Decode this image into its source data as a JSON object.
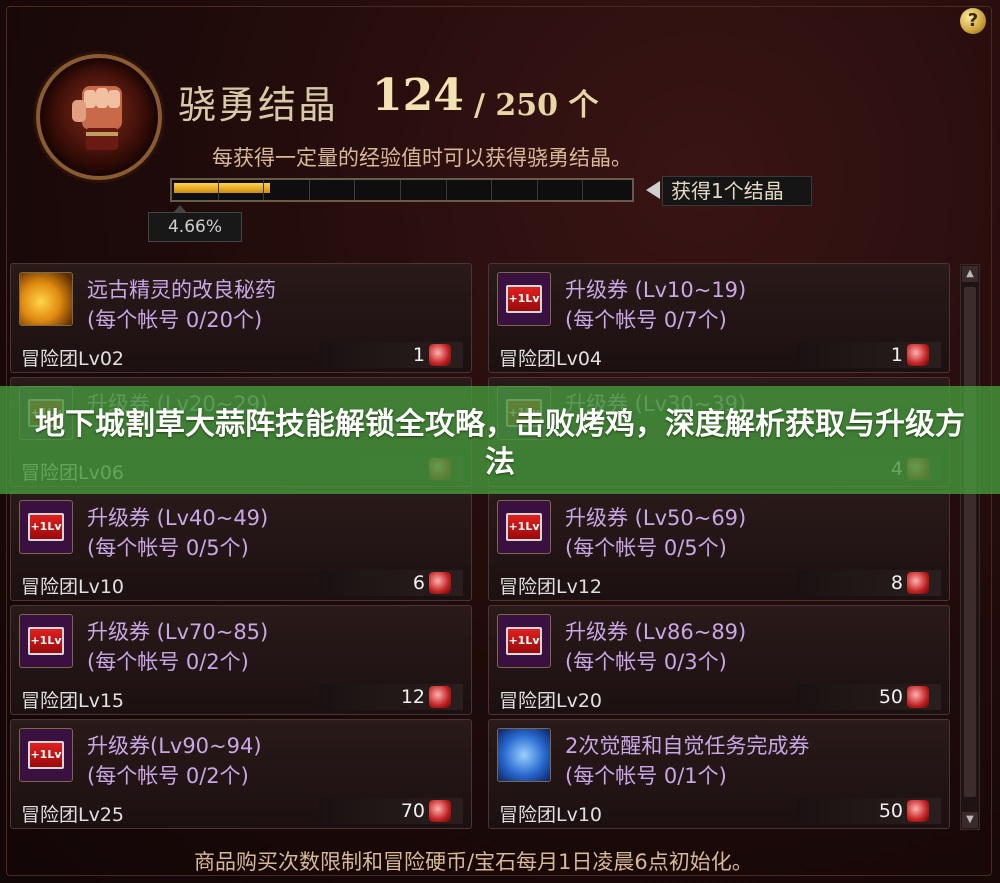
{
  "header": {
    "title": "骁勇结晶",
    "count": "124",
    "max": "/ 250 个",
    "description": "每获得一定量的经验值时可以获得骁勇结晶。",
    "progress_label": "4.66%",
    "progress": 0.0466,
    "reward_label": "获得1个结晶",
    "help": "?"
  },
  "items": [
    {
      "name": "远古精灵的改良秘药",
      "limit": "(每个帐号 0/20个)",
      "req": "冒险团Lv02",
      "price": "1",
      "icon": "potion-icon"
    },
    {
      "name": "升级券 (Lv10~19)",
      "limit": "(每个帐号 0/7个)",
      "req": "冒险团Lv04",
      "price": "1",
      "icon": "ticket-icon"
    },
    {
      "name": "升级券 (Lv20~29)",
      "limit": "",
      "req": "冒险团Lv06",
      "price": "",
      "icon": "ticket-icon"
    },
    {
      "name": "升级券 (Lv30~39)",
      "limit": "",
      "req": "",
      "price": "4",
      "icon": "ticket-icon"
    },
    {
      "name": "升级券 (Lv40~49)",
      "limit": "(每个帐号 0/5个)",
      "req": "冒险团Lv10",
      "price": "6",
      "icon": "ticket-icon"
    },
    {
      "name": "升级券 (Lv50~69)",
      "limit": "(每个帐号 0/5个)",
      "req": "冒险团Lv12",
      "price": "8",
      "icon": "ticket-icon"
    },
    {
      "name": "升级券 (Lv70~85)",
      "limit": "(每个帐号 0/2个)",
      "req": "冒险团Lv15",
      "price": "12",
      "icon": "ticket-icon"
    },
    {
      "name": "升级券 (Lv86~89)",
      "limit": "(每个帐号 0/3个)",
      "req": "冒险团Lv20",
      "price": "50",
      "icon": "ticket-icon"
    },
    {
      "name": "升级券(Lv90~94)",
      "limit": "(每个帐号 0/2个)",
      "req": "冒险团Lv25",
      "price": "70",
      "icon": "ticket-icon"
    },
    {
      "name": "2次觉醒和自觉任务完成券",
      "limit": "(每个帐号 0/1个)",
      "req": "冒险团Lv10",
      "price": "50",
      "icon": "awakening-ticket-icon"
    }
  ],
  "footer": "商品购买次数限制和冒险硬币/宝石每月1日凌晨6点初始化。",
  "banner": "地下城割草大蒜阵技能解锁全攻略，击败烤鸡，深度解析获取与升级方法",
  "scroll": {
    "up": "▲",
    "down": "▼"
  }
}
